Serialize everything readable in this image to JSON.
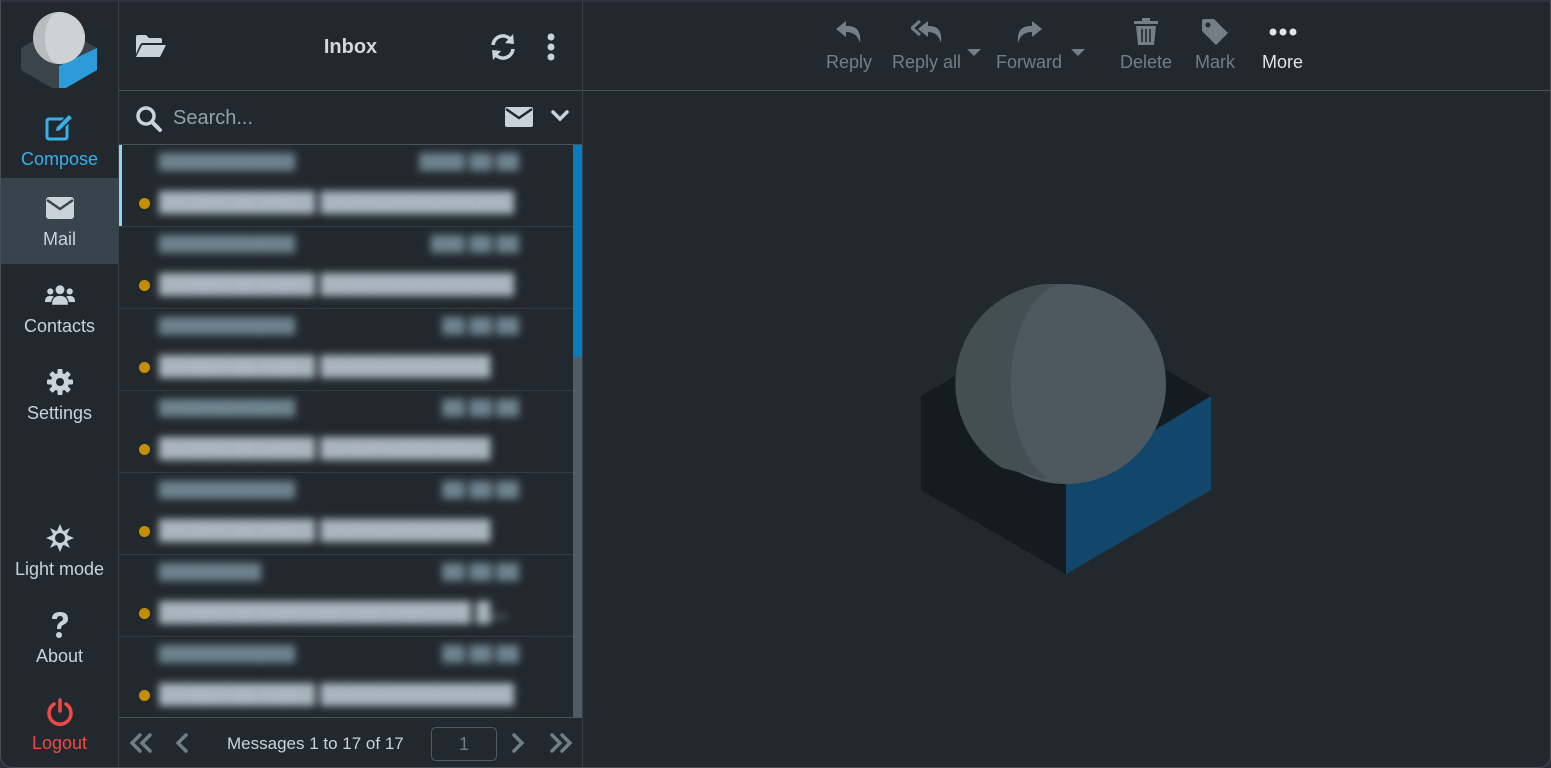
{
  "nav": {
    "logo": "roundcube-logo",
    "items": [
      {
        "id": "compose",
        "label": "Compose",
        "icon": "compose-icon"
      },
      {
        "id": "mail",
        "label": "Mail",
        "icon": "envelope-icon",
        "active": true
      },
      {
        "id": "contacts",
        "label": "Contacts",
        "icon": "users-icon"
      },
      {
        "id": "settings",
        "label": "Settings",
        "icon": "gear-icon"
      },
      {
        "id": "light-mode",
        "label": "Light mode",
        "icon": "sun-icon"
      },
      {
        "id": "about",
        "label": "About",
        "icon": "question-icon"
      },
      {
        "id": "logout",
        "label": "Logout",
        "icon": "power-icon"
      }
    ]
  },
  "list": {
    "title": "Inbox",
    "search": {
      "placeholder": "Search...",
      "value": ""
    },
    "messages": [
      {
        "from": "████████████",
        "date": "████ ██:██",
        "subject": "███████████ ███████████████",
        "unread": true,
        "selected": true
      },
      {
        "from": "████████████",
        "date": "███ ██:██",
        "subject": "███████████ ███████████████",
        "unread": true
      },
      {
        "from": "████████████",
        "date": "██ ██:██",
        "subject": "███████████ ████████████",
        "unread": true
      },
      {
        "from": "████████████",
        "date": "██ ██:██",
        "subject": "███████████ ████████████",
        "unread": true
      },
      {
        "from": "████████████",
        "date": "██ ██:██",
        "subject": "███████████ ████████████",
        "unread": true
      },
      {
        "from": "█████████",
        "date": "██ ██:██",
        "subject": "██████████████████████ █...",
        "unread": true
      },
      {
        "from": "████████████",
        "date": "██ ██:██",
        "subject": "███████████ ███████████████",
        "unread": true
      }
    ],
    "scroll_fraction_visible": 0.37,
    "footer": {
      "info": "Messages 1 to 17 of 17",
      "page": "1"
    }
  },
  "toolbar": {
    "buttons": [
      {
        "id": "reply",
        "label": "Reply",
        "icon": "reply-icon",
        "enabled": false
      },
      {
        "id": "reply-all",
        "label": "Reply all",
        "icon": "reply-all-icon",
        "enabled": false,
        "has_menu": true
      },
      {
        "id": "forward",
        "label": "Forward",
        "icon": "forward-icon",
        "enabled": false,
        "has_menu": true
      },
      {
        "id": "delete",
        "label": "Delete",
        "icon": "trash-icon",
        "enabled": false
      },
      {
        "id": "mark",
        "label": "Mark",
        "icon": "tag-icon",
        "enabled": false
      },
      {
        "id": "more",
        "label": "More",
        "icon": "more-icon",
        "enabled": true
      }
    ]
  },
  "colors": {
    "accent": "#37b0ea",
    "logout": "#f04848",
    "unread_dot": "#c58f04",
    "scroll_thumb": "#0a7bbd",
    "background": "#22292e"
  }
}
